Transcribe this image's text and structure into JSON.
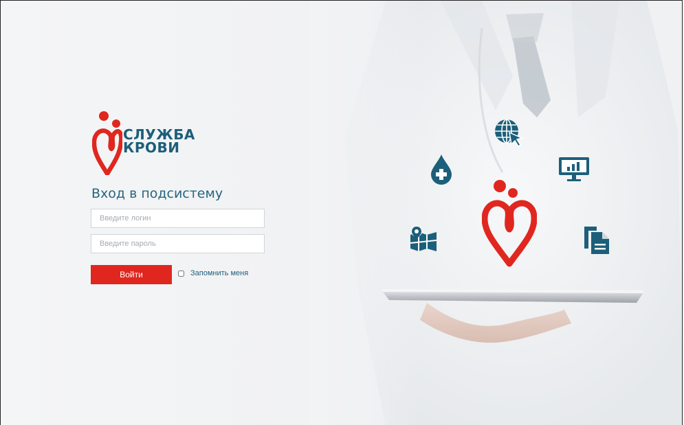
{
  "brand": {
    "name_line1": "СЛУЖБА",
    "name_line2": "КРОВИ"
  },
  "login": {
    "title": "Вход в подсистему",
    "login_placeholder": "Введите логин",
    "password_placeholder": "Введите пароль",
    "submit_label": "Войти",
    "remember_label": "Запомнить меня",
    "remember_checked": false
  },
  "colors": {
    "brand_red": "#e0271f",
    "brand_blue": "#1c5f7a",
    "icon_blue": "#1c5f7a"
  },
  "hero_icons": [
    "blood-drop-plus-icon",
    "globe-cursor-icon",
    "monitor-chart-icon",
    "map-marker-icon",
    "documents-icon",
    "heart-logo-icon"
  ]
}
